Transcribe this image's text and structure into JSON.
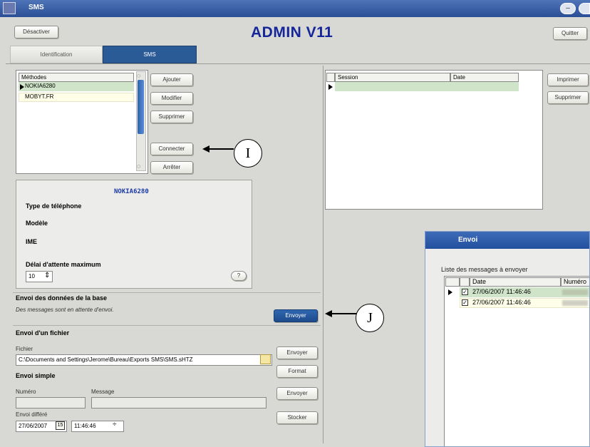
{
  "titlebar": {
    "title": "SMS"
  },
  "header": {
    "deactivate_label": "Désactiver",
    "app_title": "ADMIN V11",
    "quit_label": "Quitter"
  },
  "tabs": [
    {
      "label": "Identification"
    },
    {
      "label": "SMS"
    }
  ],
  "methods": {
    "header": "Méthodes",
    "rows": [
      "NOKIA6280",
      "MOBYT.FR"
    ],
    "buttons": {
      "add": "Ajouter",
      "modify": "Modifier",
      "delete": "Supprimer",
      "connect": "Connecter",
      "stop": "Arrêter"
    }
  },
  "details": {
    "name": "NOKIA6280",
    "phone_type_label": "Type de téléphone",
    "model_label": "Modèle",
    "ime_label": "IME",
    "max_wait_label": "Délai d'attente maximum",
    "max_wait_value": "10",
    "help_label": "?"
  },
  "db_send": {
    "title": "Envoi des données de la base",
    "message": "Des messages sont en attente d'envoi.",
    "send_label": "Envoyer"
  },
  "file_send": {
    "title": "Envoi d'un fichier",
    "file_label": "Fichier",
    "file_path": "C:\\Documents and Settings\\Jerome\\Bureau\\Exports SMS\\SMS.sHTZ",
    "send_label": "Envoyer",
    "format_label": "Format"
  },
  "simple_send": {
    "title": "Envoi simple",
    "number_label": "Numéro",
    "message_label": "Message",
    "send_label": "Envoyer",
    "deferred_label": "Envoi différé",
    "date_value": "27/06/2007",
    "time_value": "11:46:46",
    "store_label": "Stocker"
  },
  "sessions": {
    "headers": [
      "Session",
      "Date"
    ],
    "buttons": {
      "print": "Imprimer",
      "delete": "Supprimer"
    }
  },
  "annotations": {
    "i_label": "I",
    "j_label": "J"
  },
  "envoi_window": {
    "title": "Envoi",
    "list_title": "Liste des messages à envoyer",
    "headers": [
      "Date",
      "Numéro"
    ],
    "rows": [
      {
        "date": "27/06/2007 11:46:46",
        "checked": true
      },
      {
        "date": "27/06/2007 11:46:46",
        "checked": true
      }
    ]
  }
}
